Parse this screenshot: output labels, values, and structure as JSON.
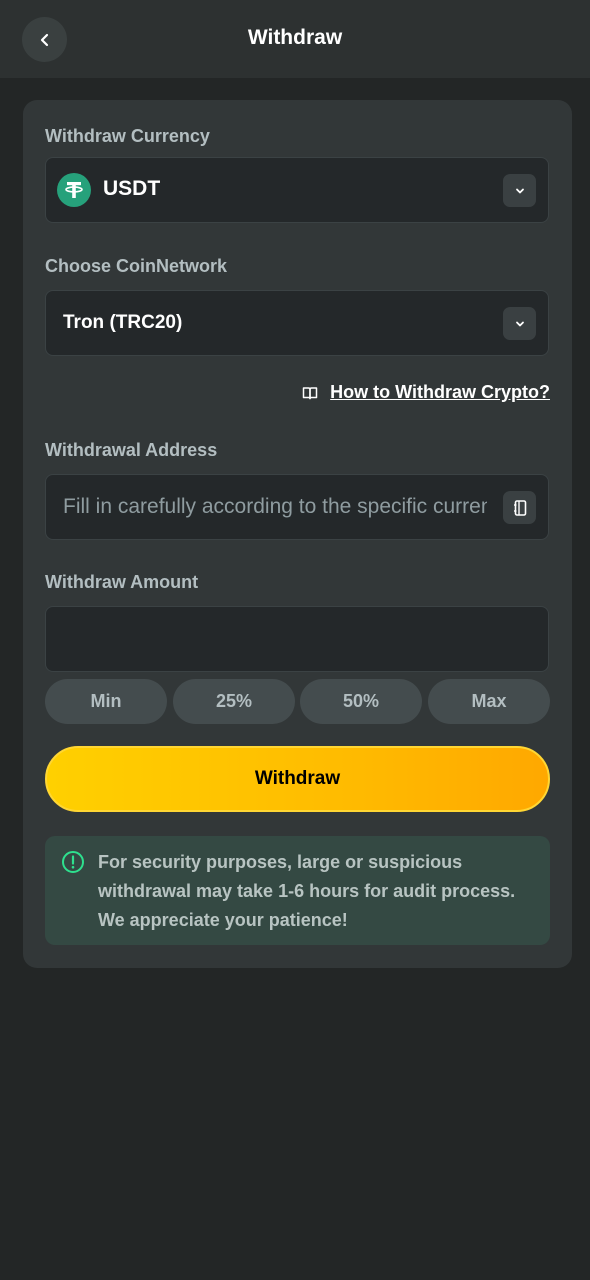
{
  "header": {
    "title": "Withdraw",
    "back_icon": "chevron-left-icon"
  },
  "currency": {
    "label": "Withdraw Currency",
    "selected": "USDT",
    "coin_icon": "tether-icon",
    "coin_color": "#26a17b"
  },
  "network": {
    "label": "Choose CoinNetwork",
    "selected": "Tron (TRC20)"
  },
  "howto": {
    "label": "How to Withdraw Crypto?",
    "icon": "book-icon"
  },
  "address": {
    "label": "Withdrawal Address",
    "placeholder": "Fill in carefully according to the specific currency",
    "value": "",
    "action_icon": "address-book-icon"
  },
  "amount": {
    "label": "Withdraw Amount",
    "value": "",
    "chips": [
      "Min",
      "25%",
      "50%",
      "Max"
    ]
  },
  "submit": {
    "label": "Withdraw"
  },
  "notice": {
    "icon": "info-icon",
    "text": "For security purposes, large or suspicious withdrawal may take 1-6 hours for audit process. We appreciate your patience!",
    "accent_color": "#2ee08e"
  },
  "colors": {
    "background": "#232626",
    "card": "#323738",
    "primary_gradient_start": "#ffd000",
    "primary_gradient_end": "#ffa800"
  }
}
